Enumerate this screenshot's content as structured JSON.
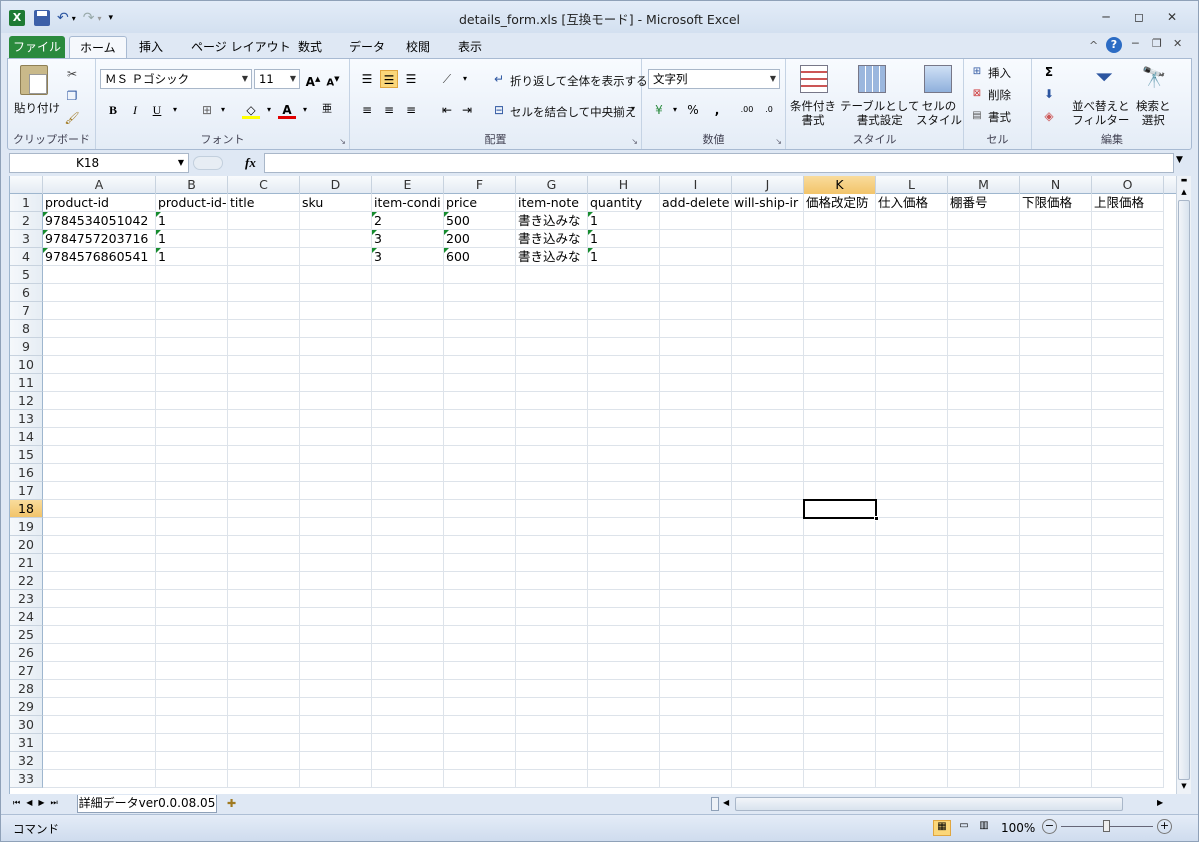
{
  "window": {
    "title": "details_form.xls  [互換モード]  -  Microsoft Excel"
  },
  "tabs": [
    "ファイル",
    "ホーム",
    "挿入",
    "ページ レイアウト",
    "数式",
    "データ",
    "校閲",
    "表示"
  ],
  "active_tab": "ホーム",
  "ribbon": {
    "clipboard": {
      "label": "クリップボード",
      "paste": "貼り付け"
    },
    "font": {
      "label": "フォント",
      "name": "ＭＳ Ｐゴシック",
      "size": "11",
      "bold": "B",
      "italic": "I",
      "underline": "U"
    },
    "alignment": {
      "label": "配置",
      "wrap": "折り返して全体を表示する",
      "merge": "セルを結合して中央揃え"
    },
    "number": {
      "label": "数値",
      "format": "文字列"
    },
    "styles": {
      "label": "スタイル",
      "conditional": "条件付き\n書式",
      "table": "テーブルとして\n書式設定",
      "cell_styles": "セルの\nスタイル"
    },
    "cells": {
      "label": "セル",
      "insert": "挿入",
      "delete": "削除",
      "format": "書式"
    },
    "editing": {
      "label": "編集",
      "sort": "並べ替えと\nフィルター",
      "find": "検索と\n選択"
    }
  },
  "formula_bar": {
    "name_box": "K18",
    "fx": "fx",
    "value": ""
  },
  "columns": [
    "A",
    "B",
    "C",
    "D",
    "E",
    "F",
    "G",
    "H",
    "I",
    "J",
    "K",
    "L",
    "M",
    "N",
    "O"
  ],
  "selected_column": "K",
  "selected_row": 18,
  "row_count": 33,
  "cells": {
    "header": [
      "product-id",
      "product-id-",
      "title",
      "sku",
      "item-condi",
      "price",
      "item-note",
      "quantity",
      "add-delete",
      "will-ship-ir",
      "価格改定防",
      "仕入価格",
      "棚番号",
      "下限価格",
      "上限価格"
    ],
    "data": [
      [
        "9784534051042",
        "1",
        "",
        "",
        "2",
        "500",
        "書き込みな",
        "1"
      ],
      [
        "9784757203716",
        "1",
        "",
        "",
        "3",
        "200",
        "書き込みな",
        "1"
      ],
      [
        "9784576860541",
        "1",
        "",
        "",
        "3",
        "600",
        "書き込みな",
        "1"
      ]
    ]
  },
  "sheet_tab": "詳細データver0.0.08.05",
  "status": {
    "mode": "コマンド",
    "zoom": "100%"
  },
  "colors": {
    "file_tab": "#2a8a3d",
    "selected_header": "#f2c46a",
    "error_triangle": "#168c2e"
  }
}
